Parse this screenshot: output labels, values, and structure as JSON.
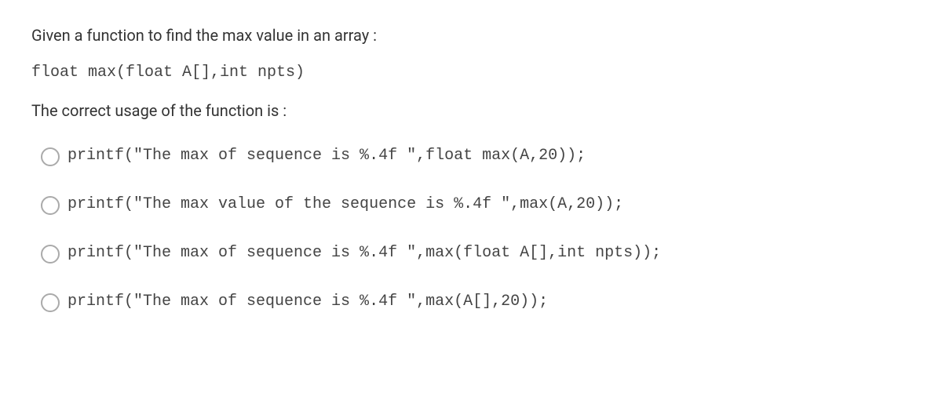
{
  "question": {
    "intro": "Given a function to find the max value in an array :",
    "signature": "float max(float A[],int npts)",
    "prompt": "The correct usage of the function is :"
  },
  "options": [
    {
      "text": "printf(\"The max of sequence is %.4f \",float max(A,20));"
    },
    {
      "text": "printf(\"The max value of the sequence is %.4f \",max(A,20));"
    },
    {
      "text": "printf(\"The max of sequence is %.4f \",max(float A[],int npts));"
    },
    {
      "text": "printf(\"The max of sequence is %.4f \",max(A[],20));"
    }
  ]
}
